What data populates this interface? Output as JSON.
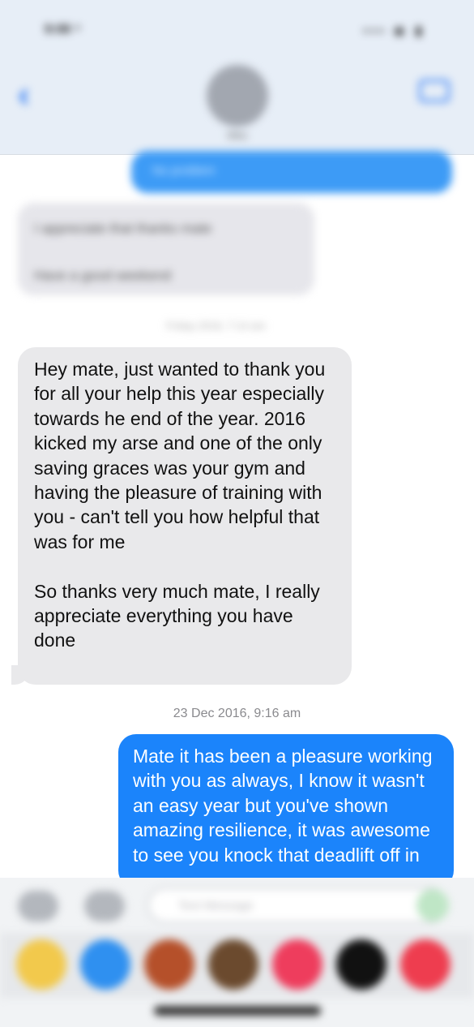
{
  "header": {
    "status_time": "9:08 ⁴",
    "status_icons": "▪▪▪ ◉ ▮",
    "contact_name": "Mike"
  },
  "history": {
    "outgoing_text": "No problem",
    "incoming_line1": "I appreciate that thanks mate",
    "incoming_line2": "Have a good weekend",
    "timestamp": "Friday 2016, 7:14 am"
  },
  "messages": {
    "incoming_p1": "Hey mate, just wanted to thank you for all your help this year especially towards he end of the year. 2016 kicked my arse and one of the only saving graces was your gym and having the pleasure of training with you - can't tell you how helpful that was for me",
    "incoming_p2": "So thanks very much mate, I really appreciate everything you have done",
    "timestamp": "23 Dec 2016, 9:16 am",
    "outgoing": "Mate it has been a pleasure working with you as always, I know it wasn't an easy year but you've shown amazing resilience, it was awesome to see you knock that deadlift off in"
  },
  "composer": {
    "placeholder": "Text Message"
  },
  "app_drawer": {
    "icons": [
      "photos-app-icon",
      "app-store-icon",
      "animoji-icon",
      "memoji-icon",
      "search-images-icon",
      "digital-touch-icon",
      "music-icon"
    ],
    "colors": [
      "#f2c94c",
      "#2f90f0",
      "#b5502a",
      "#6b4a2e",
      "#ee3d5d",
      "#111111",
      "#ee3d4f"
    ]
  },
  "colors": {
    "outgoing_bubble": "#1b84fb",
    "incoming_bubble": "#e9e9eb",
    "accent": "#2f7cf6"
  }
}
